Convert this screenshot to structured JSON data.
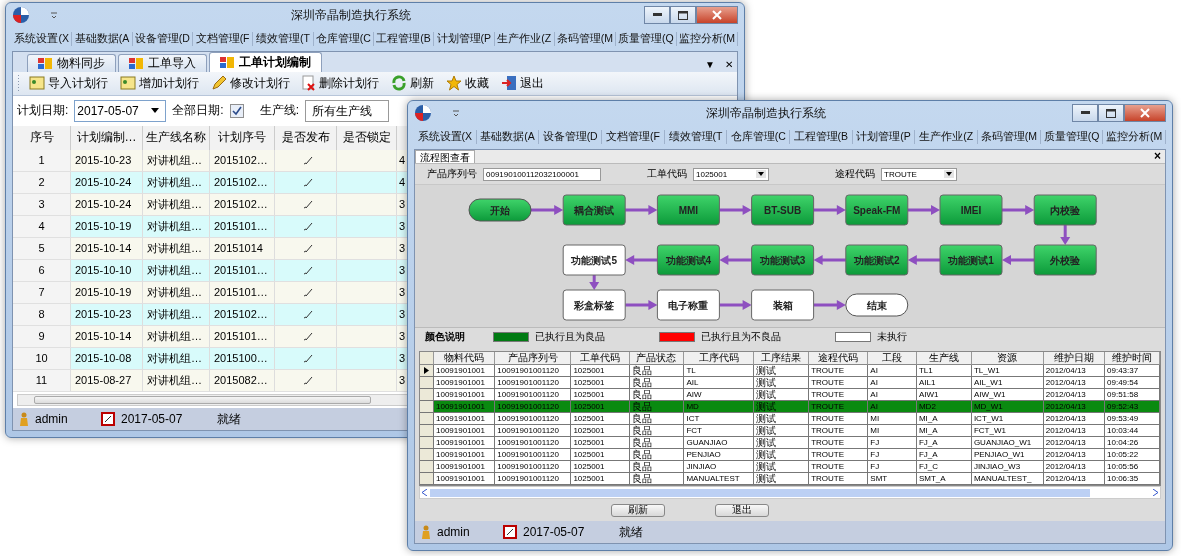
{
  "back_window": {
    "title": "深圳帝晶制造执行系统",
    "menu": [
      "系统设置(X",
      "基础数据(A",
      "设备管理(D",
      "文档管理(F",
      "绩效管理(T",
      "仓库管理(C",
      "工程管理(B",
      "计划管理(P",
      "生产作业(Z",
      "条码管理(M",
      "质量管理(Q",
      "监控分析(M"
    ],
    "tabs": [
      {
        "label": "物料同步",
        "selected": false
      },
      {
        "label": "工单导入",
        "selected": false
      },
      {
        "label": "工单计划编制",
        "selected": true
      }
    ],
    "tab_menu": "▼",
    "tab_close": "✕",
    "toolbar": [
      {
        "label": "导入计划行",
        "kind": "note"
      },
      {
        "label": "增加计划行",
        "kind": "note"
      },
      {
        "label": "修改计划行",
        "kind": "edit"
      },
      {
        "label": "删除计划行",
        "kind": "delete"
      },
      {
        "label": "刷新",
        "kind": "refresh"
      },
      {
        "label": "收藏",
        "kind": "favorite"
      },
      {
        "label": "退出",
        "kind": "exit"
      }
    ],
    "filters": {
      "date_label": "计划日期:",
      "date_value": "2017-05-07",
      "all_dates_label": "全部日期:",
      "all_dates_checked": true,
      "line_label": "生产线:",
      "line_value": "所有生产线"
    },
    "table": {
      "columns": [
        "序号",
        "计划编制…",
        "生产线名称",
        "计划序号",
        "是否发布",
        "是否锁定"
      ],
      "rows": [
        {
          "no": "1",
          "date": "2015-10-23",
          "line": "对讲机组…",
          "plan_no": "2015102…",
          "published": true,
          "column_7": "4"
        },
        {
          "no": "2",
          "date": "2015-10-24",
          "line": "对讲机组…",
          "plan_no": "2015102…",
          "published": true,
          "column_7": "4"
        },
        {
          "no": "3",
          "date": "2015-10-24",
          "line": "对讲机组…",
          "plan_no": "2015102…",
          "published": true,
          "column_7": "3"
        },
        {
          "no": "4",
          "date": "2015-10-19",
          "line": "对讲机组…",
          "plan_no": "2015101…",
          "published": true,
          "column_7": "3"
        },
        {
          "no": "5",
          "date": "2015-10-14",
          "line": "对讲机组…",
          "plan_no": "20151014",
          "published": true,
          "column_7": "3"
        },
        {
          "no": "6",
          "date": "2015-10-10",
          "line": "对讲机组…",
          "plan_no": "2015101…",
          "published": true,
          "column_7": "3"
        },
        {
          "no": "7",
          "date": "2015-10-19",
          "line": "对讲机组…",
          "plan_no": "2015101…",
          "published": true,
          "column_7": "3"
        },
        {
          "no": "8",
          "date": "2015-10-23",
          "line": "对讲机组…",
          "plan_no": "2015102…",
          "published": true,
          "column_7": "3"
        },
        {
          "no": "9",
          "date": "2015-10-14",
          "line": "对讲机组…",
          "plan_no": "2015101…",
          "published": true,
          "column_7": "3"
        },
        {
          "no": "10",
          "date": "2015-10-08",
          "line": "对讲机组…",
          "plan_no": "2015100…",
          "published": true,
          "column_7": "3"
        },
        {
          "no": "11",
          "date": "2015-08-27",
          "line": "对讲机组…",
          "plan_no": "2015082…",
          "published": true,
          "column_7": "3"
        }
      ]
    },
    "status_bar": {
      "user": "admin",
      "date": "2017-05-07",
      "status": "就绪"
    }
  },
  "front_window": {
    "title": "深圳帝晶制造执行系统",
    "menu": [
      "系统设置(X",
      "基础数据(A",
      "设备管理(D",
      "文档管理(F",
      "绩效管理(T",
      "仓库管理(C",
      "工程管理(B",
      "计划管理(P",
      "生产作业(Z",
      "条码管理(M",
      "质量管理(Q",
      "监控分析(M"
    ],
    "tab": "流程图查看",
    "tab_close": "×",
    "fields": [
      {
        "label": "产品序列号",
        "value": "009190100112032100001",
        "kind": "text"
      },
      {
        "label": "工单代码",
        "value": "1025001",
        "kind": "dropdown"
      },
      {
        "label": "途程代码",
        "value": "TROUTE",
        "kind": "dropdown"
      }
    ],
    "flow_rows": [
      {
        "reversed": false,
        "nodes": [
          {
            "label": "开始",
            "kind": "terminal",
            "done": true
          },
          {
            "label": "耦合测试",
            "kind": "step",
            "done": true
          },
          {
            "label": "MMI",
            "kind": "step",
            "done": true
          },
          {
            "label": "BT-SUB",
            "kind": "step",
            "done": true
          },
          {
            "label": "Speak-FM",
            "kind": "step",
            "done": true
          },
          {
            "label": "IMEI",
            "kind": "step",
            "done": true
          },
          {
            "label": "内校验",
            "kind": "step",
            "done": true
          }
        ]
      },
      {
        "reversed": true,
        "nodes": [
          {
            "label": "功能测试5",
            "kind": "step",
            "done": false
          },
          {
            "label": "功能测试4",
            "kind": "step",
            "done": true
          },
          {
            "label": "功能测试3",
            "kind": "step",
            "done": true
          },
          {
            "label": "功能测试2",
            "kind": "step",
            "done": true
          },
          {
            "label": "功能测试1",
            "kind": "step",
            "done": true
          },
          {
            "label": "外校验",
            "kind": "step",
            "done": true
          }
        ]
      },
      {
        "reversed": false,
        "nodes": [
          {
            "label": "彩盒标签",
            "kind": "step",
            "done": false
          },
          {
            "label": "电子称重",
            "kind": "step",
            "done": false
          },
          {
            "label": "装箱",
            "kind": "step",
            "done": false
          },
          {
            "label": "结束",
            "kind": "terminal",
            "done": false
          }
        ]
      }
    ],
    "legend": {
      "title": "颜色说明",
      "items": [
        {
          "label": "已执行且为良品",
          "color": "#007a12"
        },
        {
          "label": "已执行且为不良品",
          "color": "#ff0000"
        },
        {
          "label": "未执行",
          "color": "#ffffff"
        }
      ]
    },
    "table": {
      "columns": [
        "物料代码",
        "产品序列号",
        "工单代码",
        "产品状态",
        "工序代码",
        "工序结果",
        "途程代码",
        "工段",
        "生产线",
        "资源",
        "维护日期",
        "维护时间"
      ],
      "rows": [
        {
          "current": true,
          "selected": false,
          "cells": [
            "10091901001",
            "10091901001120",
            "1025001",
            "良品",
            "TL",
            "测试",
            "TROUTE",
            "AI",
            "TL1",
            "TL_W1",
            "2012/04/13",
            "09:43:37"
          ]
        },
        {
          "current": false,
          "selected": false,
          "cells": [
            "10091901001",
            "10091901001120",
            "1025001",
            "良品",
            "AIL",
            "测试",
            "TROUTE",
            "AI",
            "AIL1",
            "AIL_W1",
            "2012/04/13",
            "09:49:54"
          ]
        },
        {
          "current": false,
          "selected": false,
          "cells": [
            "10091901001",
            "10091901001120",
            "1025001",
            "良品",
            "AIW",
            "测试",
            "TROUTE",
            "AI",
            "AIW1",
            "AIW_W1",
            "2012/04/13",
            "09:51:58"
          ]
        },
        {
          "current": false,
          "selected": true,
          "cells": [
            "10091901001",
            "10091901001120",
            "1025001",
            "良品",
            "MD",
            "测试",
            "TROUTE",
            "AI",
            "MD2",
            "MD_W1",
            "2012/04/13",
            "09:52:43"
          ]
        },
        {
          "current": false,
          "selected": false,
          "cells": [
            "10091901001",
            "10091901001120",
            "1025001",
            "良品",
            "ICT",
            "测试",
            "TROUTE",
            "MI",
            "MI_A",
            "ICT_W1",
            "2012/04/13",
            "09:53:49"
          ]
        },
        {
          "current": false,
          "selected": false,
          "cells": [
            "10091901001",
            "10091901001120",
            "1025001",
            "良品",
            "FCT",
            "测试",
            "TROUTE",
            "MI",
            "MI_A",
            "FCT_W1",
            "2012/04/13",
            "10:03:44"
          ]
        },
        {
          "current": false,
          "selected": false,
          "cells": [
            "10091901001",
            "10091901001120",
            "1025001",
            "良品",
            "GUANJIAO",
            "测试",
            "TROUTE",
            "FJ",
            "FJ_A",
            "GUANJIAO_W1",
            "2012/04/13",
            "10:04:26"
          ]
        },
        {
          "current": false,
          "selected": false,
          "cells": [
            "10091901001",
            "10091901001120",
            "1025001",
            "良品",
            "PENJIAO",
            "测试",
            "TROUTE",
            "FJ",
            "FJ_A",
            "PENJIAO_W1",
            "2012/04/13",
            "10:05:22"
          ]
        },
        {
          "current": false,
          "selected": false,
          "cells": [
            "10091901001",
            "10091901001120",
            "1025001",
            "良品",
            "JINJIAO",
            "测试",
            "TROUTE",
            "FJ",
            "FJ_C",
            "JINJIAO_W3",
            "2012/04/13",
            "10:05:56"
          ]
        },
        {
          "current": false,
          "selected": false,
          "cells": [
            "10091901001",
            "10091901001120",
            "1025001",
            "良品",
            "MANUALTEST",
            "测试",
            "TROUTE",
            "SMT",
            "SMT_A",
            "MANUALTEST_",
            "2012/04/13",
            "10:06:35"
          ]
        }
      ]
    },
    "buttons": [
      "刷新",
      "退出"
    ],
    "status_bar": {
      "user": "admin",
      "date": "2017-05-07",
      "status": "就绪"
    }
  }
}
